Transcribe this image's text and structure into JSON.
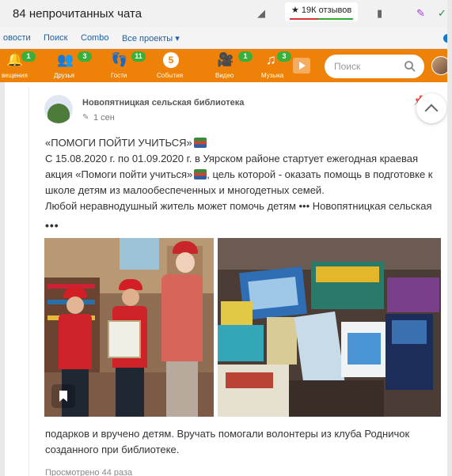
{
  "browser": {
    "tab_title": "84 непрочитанных чата",
    "reviews_label": "★ 19К отзывов"
  },
  "links": [
    "овости",
    "Поиск",
    "Combo",
    "Все проекты ▾"
  ],
  "ok_nav": {
    "items": [
      {
        "label": "вещения",
        "badge": "1",
        "icon": "bell-icon"
      },
      {
        "label": "Друзья",
        "badge": "3",
        "icon": "friends-icon"
      },
      {
        "label": "Гости",
        "badge": "11",
        "icon": "footprints-icon"
      },
      {
        "label": "События",
        "badge": "",
        "icon": "events-icon"
      },
      {
        "label": "Видео",
        "badge": "1",
        "icon": "video-camera-icon"
      },
      {
        "label": "Музыка",
        "badge": "3",
        "icon": "music-note-icon"
      }
    ],
    "events_count": "5",
    "search_placeholder": "Поиск"
  },
  "post": {
    "author": "Новопятницкая сельская библиотека",
    "time": "1 сен",
    "lines": [
      "«ПОМОГИ ПОЙТИ УЧИТЬСЯ»",
      "С 15.08.2020 г. по 01.09.2020 г. в Уярском районе стартует ежегодная краевая",
      "акция «Помоги пойти учиться»",
      ", цель которой - оказать помощь в подготовке к",
      "школе детям из малообеспеченных и многодетных семей.",
      "Любой неравнодушный житель может помочь детям ••• Новопятницкая сельская"
    ],
    "more": "•••",
    "caption_lines": [
      "подарков и вручено детям. Вручать помогали волонтеры из клуба Родничок",
      "созданного при библиотеке."
    ],
    "views": "Просмотрено 44 раза"
  }
}
